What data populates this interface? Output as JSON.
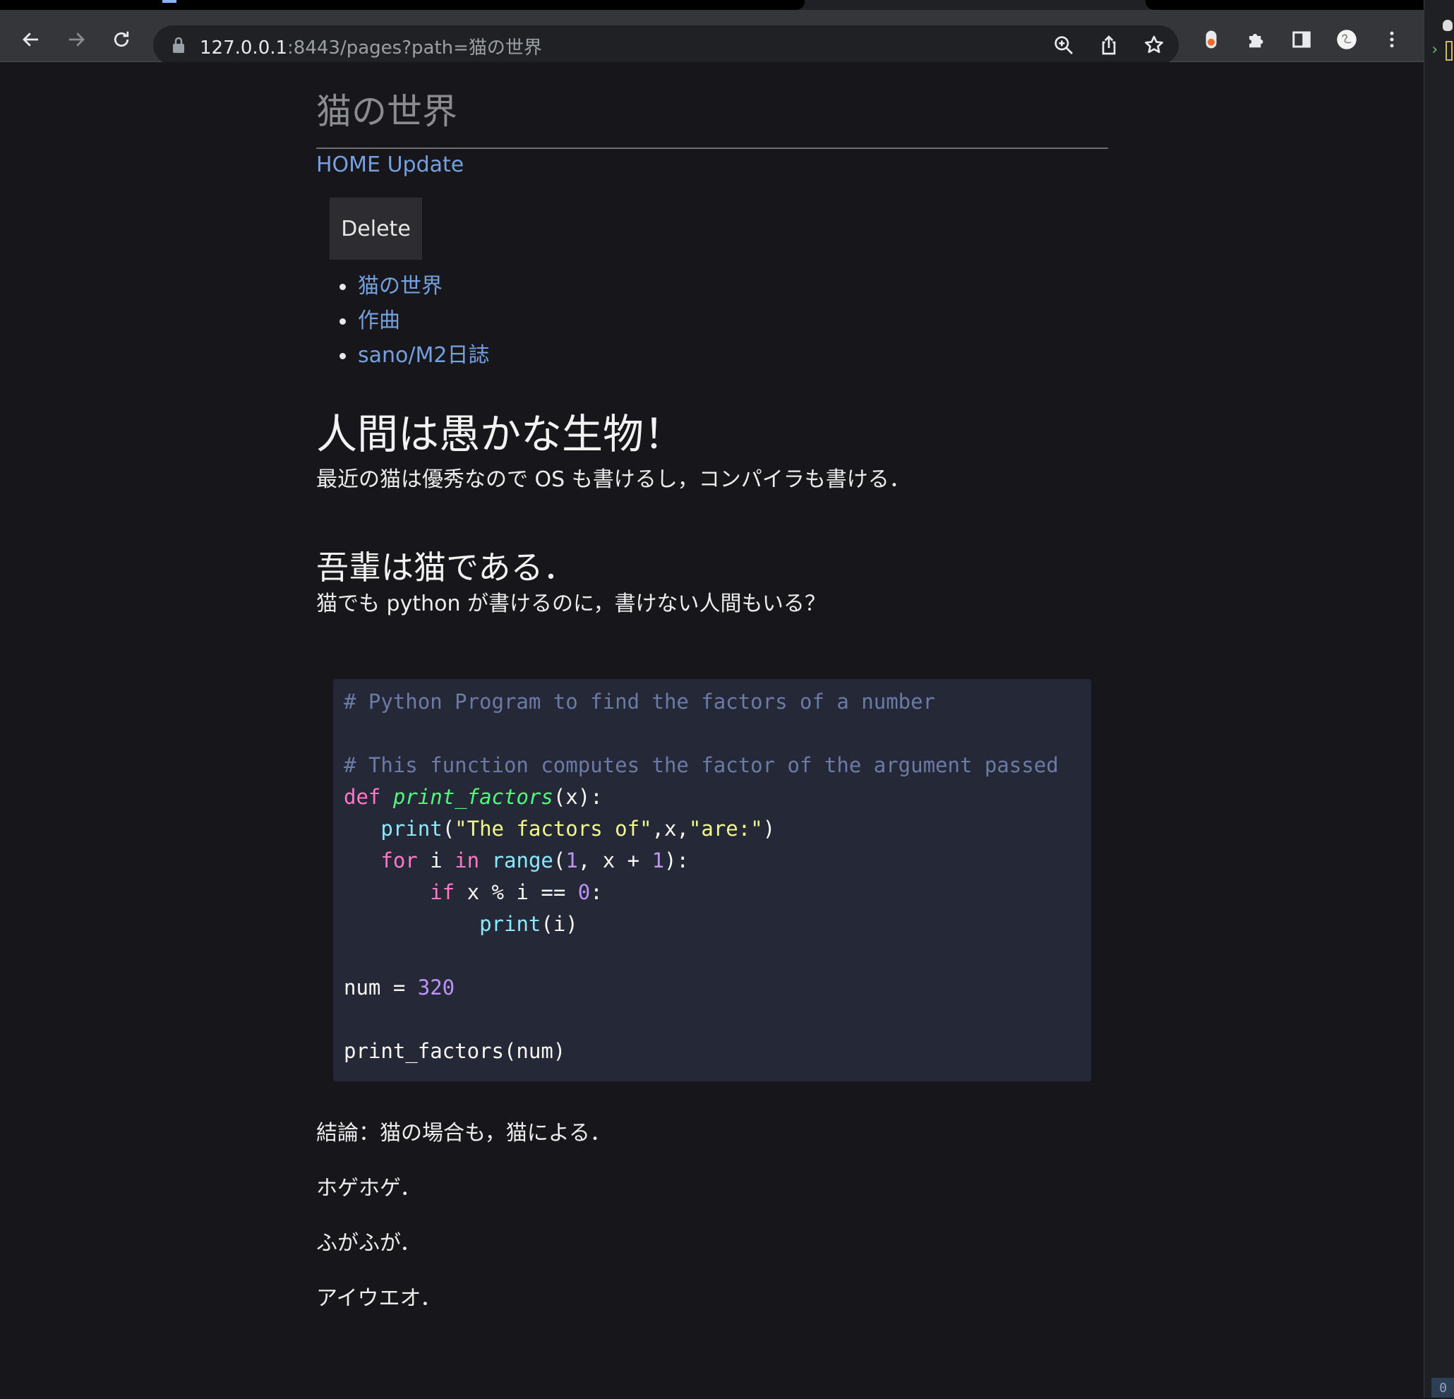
{
  "browser": {
    "url_host": "127.0.0.1",
    "url_rest": ":8443/pages?path=猫の世界"
  },
  "side_strip": {
    "counter": "0"
  },
  "page": {
    "site_title": "猫の世界",
    "nav": {
      "home": "HOME",
      "update": "Update"
    },
    "delete_label": "Delete",
    "pages": [
      "猫の世界",
      "作曲",
      "sano/M2日誌"
    ],
    "heading1": "人間は愚かな生物！",
    "intro": "最近の猫は優秀なので OS も書けるし，コンパイラも書ける．",
    "heading2": "吾輩は猫である．",
    "code_intro": "猫でも python が書けるのに，書けない人間もいる？",
    "code": {
      "language": "python",
      "comment1": "# Python Program to find the factors of a number",
      "comment2": "# This function computes the factor of the argument passed",
      "kw_def": "def",
      "func_name": "print_factors",
      "params": "(x):",
      "builtin_print": "print",
      "print_args_open": "(",
      "print_str1": "\"The factors of\"",
      "print_sep": ",x,",
      "print_str2": "\"are:\"",
      "print_args_close": ")",
      "kw_for": "for",
      "loop_var": " i ",
      "kw_in": "in",
      "builtin_range": "range",
      "range_open": "(",
      "range_start": "1",
      "range_mid": ", x + ",
      "range_end": "1",
      "range_close": "):",
      "kw_if": "if",
      "cond": " x % i == ",
      "zero": "0",
      "colon": ":",
      "print_i": "(i)",
      "num_assign": "num = ",
      "num_value": "320",
      "call": "print_factors(num)"
    },
    "conclusion": "結論：猫の場合も，猫による．",
    "line_hoge": "ホゲホゲ．",
    "line_fuga": "ふがふが．",
    "line_aiueo": "アイウエオ．"
  },
  "colors": {
    "page_bg": "#17171b",
    "link": "#74a0e0",
    "code_bg": "#252837",
    "code_keyword": "#ff79c6",
    "code_function": "#50fa7b",
    "code_builtin": "#8be9fd",
    "code_string": "#f1fa8c",
    "code_number": "#bd93f9",
    "code_comment": "#6c7aa6"
  },
  "icons": [
    "back-icon",
    "forward-icon",
    "reload-icon",
    "lock-icon",
    "zoom-icon",
    "share-icon",
    "bookmark-star-icon",
    "extension-record-icon",
    "extensions-puzzle-icon",
    "side-panel-icon",
    "profile-avatar",
    "menu-kebab-icon"
  ]
}
